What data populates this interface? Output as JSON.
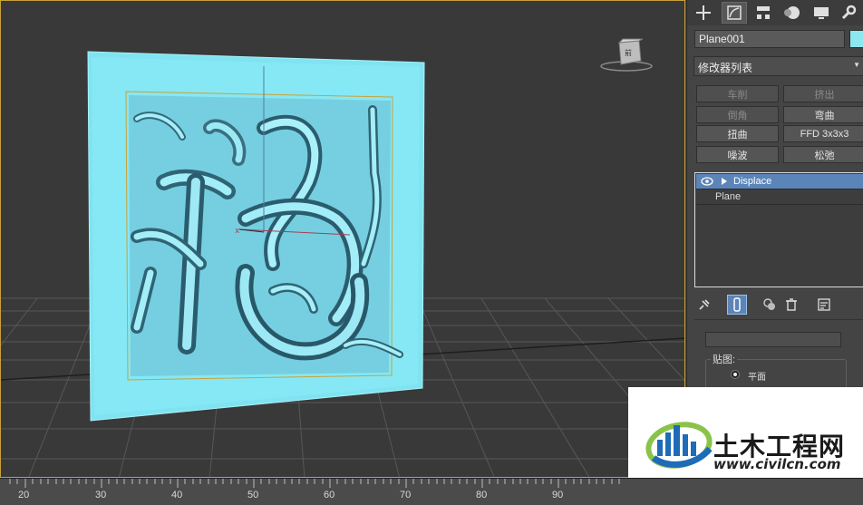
{
  "tabs": [
    {
      "icon": "create-plus-icon"
    },
    {
      "icon": "modify-icon",
      "active": true
    },
    {
      "icon": "hierarchy-icon"
    },
    {
      "icon": "motion-icon"
    },
    {
      "icon": "display-icon"
    },
    {
      "icon": "utilities-wrench-icon"
    }
  ],
  "object": {
    "name": "Plane001",
    "color": "#8ee7ef"
  },
  "modifier_list": {
    "label": "修改器列表"
  },
  "modifier_buttons": [
    {
      "label": "车削",
      "enabled": false
    },
    {
      "label": "挤出",
      "enabled": false
    },
    {
      "label": "倒角",
      "enabled": false
    },
    {
      "label": "弯曲",
      "enabled": true
    },
    {
      "label": "扭曲",
      "enabled": true
    },
    {
      "label": "FFD 3x3x3",
      "enabled": true
    },
    {
      "label": "噪波",
      "enabled": true
    },
    {
      "label": "松弛",
      "enabled": true
    }
  ],
  "stack": [
    {
      "label": "Displace",
      "selected": true
    },
    {
      "label": "Plane",
      "selected": false
    }
  ],
  "map_group": {
    "title": "贴图:",
    "option_planar": "平面"
  },
  "timeline": {
    "ticks": [
      "20",
      "30",
      "40",
      "50",
      "60",
      "70",
      "80",
      "90"
    ]
  },
  "watermark": {
    "title": "土木工程网",
    "url": "www.civilcn.com"
  }
}
